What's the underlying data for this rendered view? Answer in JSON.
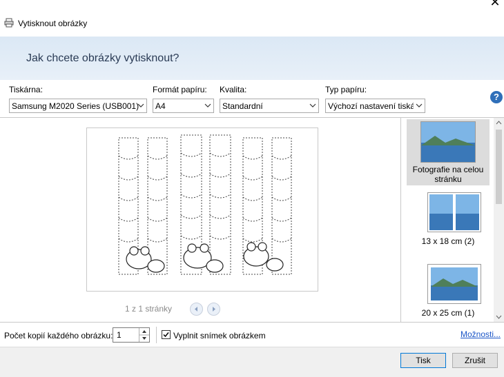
{
  "window": {
    "title": "Vytisknout obrázky",
    "heading": "Jak chcete obrázky vytisknout?"
  },
  "options": {
    "printer_label": "Tiskárna:",
    "printer_value": "Samsung M2020 Series (USB001)",
    "paper_size_label": "Formát papíru:",
    "paper_size_value": "A4",
    "quality_label": "Kvalita:",
    "quality_value": "Standardní",
    "paper_type_label": "Typ papíru:",
    "paper_type_value": "Výchozí nastavení tiská",
    "help_glyph": "?"
  },
  "preview": {
    "page_indicator": "1 z 1 stránky"
  },
  "layouts": [
    {
      "label": "Fotografie na celou stránku",
      "selected": true
    },
    {
      "label": "13 x 18 cm (2)",
      "selected": false
    },
    {
      "label": "20 x 25 cm (1)",
      "selected": false
    }
  ],
  "bottom": {
    "copies_label": "Počet kopií každého obrázku:",
    "copies_value": "1",
    "fit_label": "Vyplnit snímek obrázkem",
    "fit_checked": true,
    "options_link": "Možnosti..."
  },
  "buttons": {
    "print": "Tisk",
    "cancel": "Zrušit"
  },
  "colors": {
    "header_bg": "#dbe8f5",
    "link": "#1a55c7",
    "accent": "#0078d7"
  }
}
